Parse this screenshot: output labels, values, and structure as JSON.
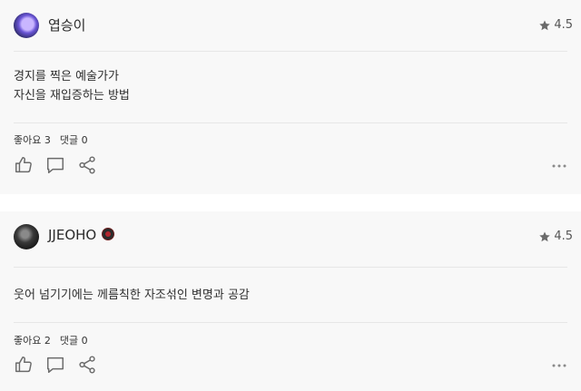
{
  "reviews": [
    {
      "username": "엽승이",
      "rating": "4.5",
      "text": "경지를 찍은 예술가가\n자신을 재입증하는 방법",
      "likes": "좋아요 3",
      "comments": "댓글 0"
    },
    {
      "username": "JJEOHO",
      "rating": "4.5",
      "text": "웃어 넘기기에는 께름칙한 자조섞인 변명과 공감",
      "likes": "좋아요 2",
      "comments": "댓글 0"
    }
  ],
  "colors": {
    "card_bg": "#f8f8f8",
    "icon_gray": "#6b6b6b",
    "text": "#2e2e2e"
  },
  "icons": [
    "star-icon",
    "thumbs-up-icon",
    "comment-icon",
    "share-icon",
    "more-icon"
  ]
}
